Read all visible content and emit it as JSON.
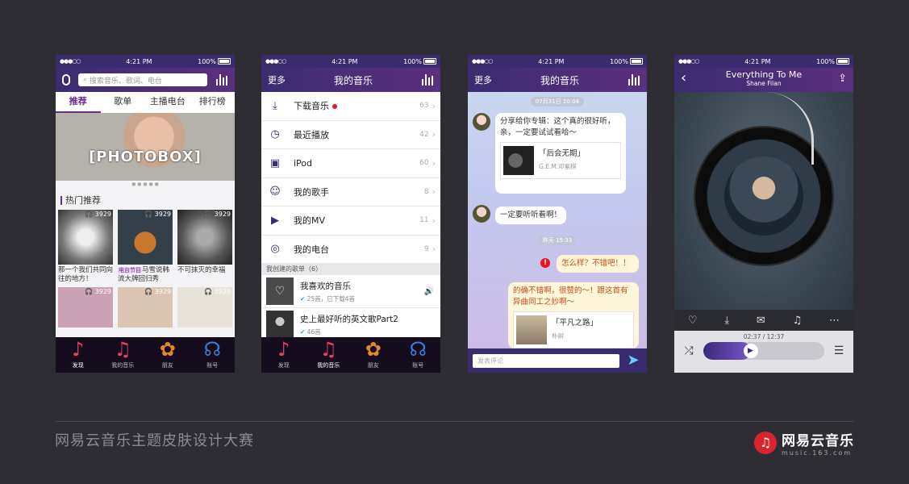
{
  "colors": {
    "background": "#2e2d33",
    "accent": "#6b2d8c",
    "nav": "#3b2c72",
    "brand_red": "#d9232d"
  },
  "status": {
    "time": "4:21 PM",
    "battery": "100%"
  },
  "phone1": {
    "search_placeholder": "搜索音乐、歌词、电台",
    "tabs": [
      "推荐",
      "歌单",
      "主播电台",
      "排行榜"
    ],
    "banner_text": "[PHOTOBOX]",
    "pager": "● ● ● ● ●",
    "section_title": "热门推荐",
    "tiles": [
      {
        "count": "3929",
        "caption": "那一个我们共同向往的地方！"
      },
      {
        "count": "3929",
        "tag": "电台节目",
        "caption": "马雪说韩流大牌回归秀"
      },
      {
        "count": "3929",
        "caption": "不可抹灭的幸福"
      }
    ],
    "tiles_row2": [
      {
        "count": "3929"
      },
      {
        "count": "3929"
      },
      {
        "count": "3929"
      }
    ]
  },
  "bottom_nav": [
    "发现",
    "我的音乐",
    "朋友",
    "账号"
  ],
  "phone2": {
    "left": "更多",
    "title": "我的音乐",
    "rows": [
      {
        "label": "下载音乐",
        "count": "63",
        "icon": "download-icon",
        "glyph": "⤓"
      },
      {
        "label": "最近播放",
        "count": "42",
        "icon": "clock-icon",
        "glyph": "◷"
      },
      {
        "label": "iPod",
        "count": "60",
        "icon": "ipod-icon",
        "glyph": "▣"
      },
      {
        "label": "我的歌手",
        "count": "8",
        "icon": "singer-icon",
        "glyph": "☺"
      },
      {
        "label": "我的MV",
        "count": "11",
        "icon": "mv-icon",
        "glyph": "▶"
      },
      {
        "label": "我的电台",
        "count": "9",
        "icon": "radio-icon",
        "glyph": "◎"
      }
    ],
    "subhead": "我创建的歌单（6）",
    "playlists": [
      {
        "title": "我喜欢的音乐",
        "sub": "25首，已下载4首"
      },
      {
        "title": "史上最好听的英文歌Part2",
        "sub": "46首"
      }
    ]
  },
  "phone3": {
    "left": "更多",
    "title": "我的音乐",
    "stamp1": "07月31日 20:04",
    "msg1": "分享给你专辑：这个真的很好听，亲，一定要试试看哈～",
    "card1_title": "「后会无期」",
    "card1_sub": "G.E.M.邓紫棋",
    "msg2": "一定要听听看啊！",
    "stamp2": "昨天 15:33",
    "msg3": "怎么样？不错吧！！",
    "msg4": "的确不错啊，很赞的～！跟这首有异曲同工之妙啊～",
    "card2_title": "「平凡之路」",
    "card2_sub": "朴树",
    "composer_placeholder": "发表评论"
  },
  "phone4": {
    "song": "Everything To Me",
    "artist": "Shane Filan",
    "time": "02:37 / 12:37",
    "progress": 0.33
  },
  "footer": {
    "title": "网易云音乐主题皮肤设计大赛",
    "brand_name": "网易云音乐",
    "brand_url": "music.163.com"
  }
}
